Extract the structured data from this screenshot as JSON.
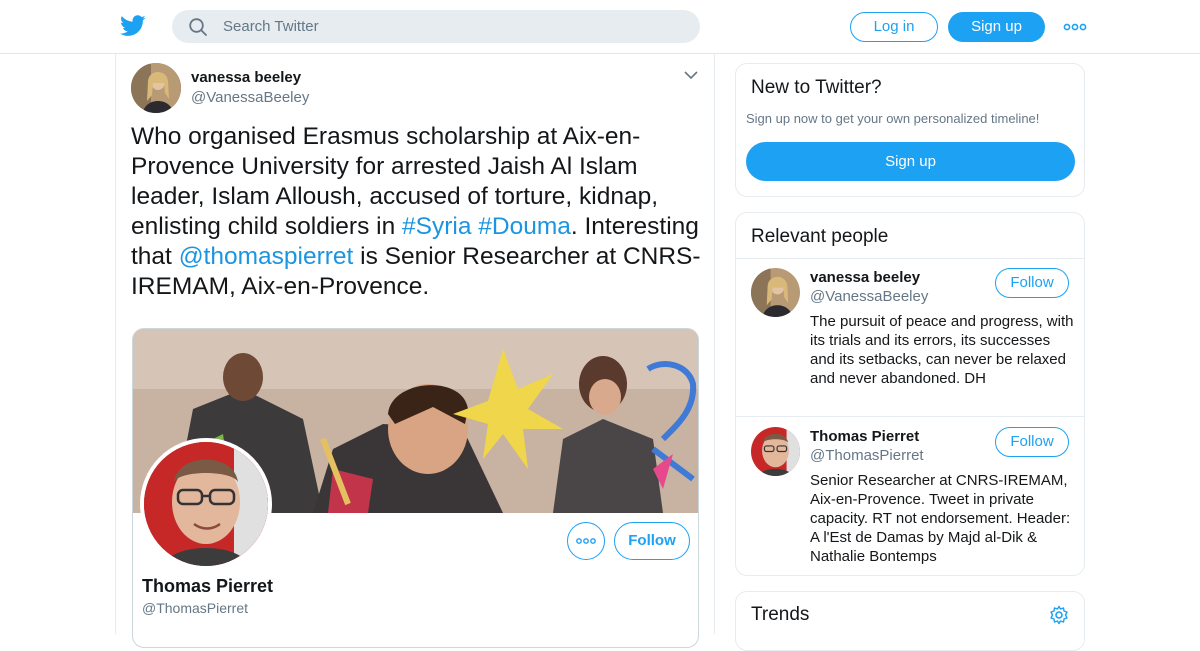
{
  "search": {
    "placeholder": "Search Twitter"
  },
  "header": {
    "login_label": "Log in",
    "signup_label": "Sign up"
  },
  "tweet": {
    "author_name": "vanessa beeley",
    "author_handle": "@VanessaBeeley",
    "text_part1": "Who organised Erasmus scholarship at Aix-en-Provence University for arrested Jaish Al Islam leader, Islam Alloush, accused of torture, kidnap, enlisting child soldiers in ",
    "hashtag1": "#Syria",
    "hashtag2": "#Douma",
    "text_part2": ". Interesting that ",
    "mention": "@thomaspierret",
    "text_part3": " is Senior Researcher at CNRS-IREMAM, Aix-en-Provence."
  },
  "card": {
    "name": "Thomas Pierret",
    "handle": "@ThomasPierret",
    "follow_label": "Follow"
  },
  "new_to_twitter": {
    "title": "New to Twitter?",
    "subtitle": "Sign up now to get your own personalized timeline!",
    "signup_label": "Sign up"
  },
  "relevant_people": {
    "title": "Relevant people",
    "people": [
      {
        "name": "vanessa beeley",
        "handle": "@VanessaBeeley",
        "bio": "The pursuit of peace and progress, with its trials and its errors, its successes and its setbacks, can never be relaxed and never abandoned. DH",
        "follow_label": "Follow"
      },
      {
        "name": "Thomas Pierret",
        "handle": "@ThomasPierret",
        "bio": "Senior Researcher at CNRS-IREMAM, Aix-en-Provence. Tweet in private capacity. RT not endorsement. Header: A l'Est de Damas by Majd al-Dik & Nathalie Bontemps",
        "follow_label": "Follow"
      }
    ]
  },
  "trends": {
    "title": "Trends"
  },
  "colors": {
    "accent": "#1da1f2",
    "link": "#1b95e0",
    "secondary_text": "#657786",
    "border": "#e6ecf0"
  }
}
